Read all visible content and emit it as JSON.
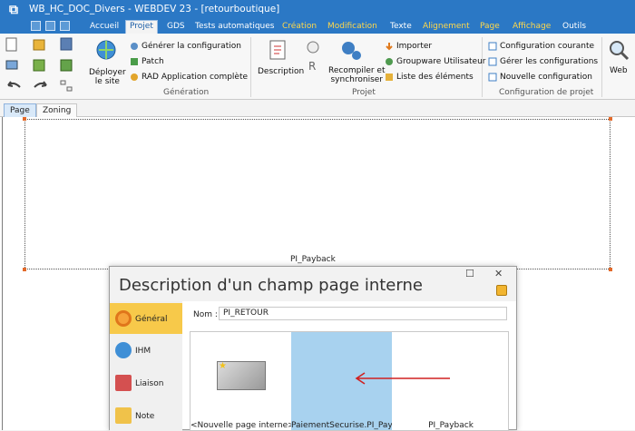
{
  "window": {
    "title": "WB_HC_DOC_Divers - WEBDEV 23 - [retourboutique]"
  },
  "menu": {
    "tabs": [
      {
        "label": "Accueil"
      },
      {
        "label": "Projet"
      },
      {
        "label": "GDS"
      },
      {
        "label": "Tests automatiques"
      },
      {
        "label": "Création"
      },
      {
        "label": "Modification"
      },
      {
        "label": "Texte"
      },
      {
        "label": "Alignement"
      },
      {
        "label": "Page"
      },
      {
        "label": "Affichage"
      },
      {
        "label": "Outils"
      }
    ]
  },
  "ribbon": {
    "deploy": "Déployer\nle site",
    "generation": {
      "label": "Génération",
      "items": [
        "Générer la configuration",
        "Patch",
        "RAD Application complète"
      ]
    },
    "projet": {
      "label": "Projet",
      "description": "Description",
      "recompile": "Recompiler et\nsynchroniser",
      "items": [
        "Importer",
        "Groupware Utilisateur",
        "Liste des éléments"
      ]
    },
    "config": {
      "label": "Configuration de projet",
      "items": [
        "Configuration courante",
        "Gérer les configurations",
        "Nouvelle configuration"
      ]
    },
    "web": "Web"
  },
  "pagetabs": [
    {
      "label": "Page"
    },
    {
      "label": "Zoning"
    }
  ],
  "editor": {
    "frame_label": "PI_Payback"
  },
  "dialog": {
    "title": "Description d'un champ page interne",
    "sidebar": [
      {
        "label": "Général"
      },
      {
        "label": "IHM"
      },
      {
        "label": "Liaison"
      },
      {
        "label": "Note"
      }
    ],
    "nom_label": "Nom :",
    "nom_value": "PI_RETOUR",
    "gallery": [
      {
        "label": "<Nouvelle page interne>"
      },
      {
        "label": "PaiementSecurise.PI_Payback"
      },
      {
        "label": "PI_Payback"
      }
    ]
  }
}
